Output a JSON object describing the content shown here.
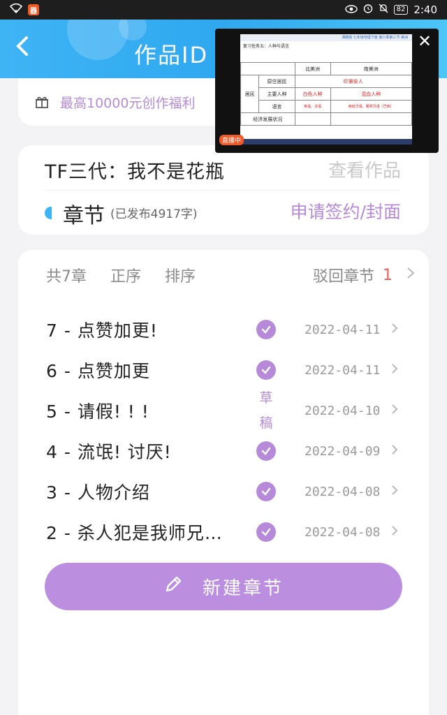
{
  "status_bar": {
    "time": "2:40",
    "battery": "82",
    "app_badge": "器"
  },
  "header": {
    "title": "作品ID",
    "back_label": "‹"
  },
  "benefit": {
    "text": "最高10000元创作福利"
  },
  "work": {
    "title": "TF三代：我不是花瓶",
    "view_works": "查看作品",
    "chapter_label": "章节",
    "published_count": "(已发布4917字)",
    "apply_sign": "申请签约/封面"
  },
  "chapter_list": {
    "total": "共7章",
    "order": "正序",
    "sort": "排序",
    "rejected_label": "驳回章节",
    "rejected_count": "1",
    "chapters": [
      {
        "title": "7 - 点赞加更!",
        "status": "published",
        "date": "2022-04-11"
      },
      {
        "title": "6 - 点赞加更",
        "status": "published",
        "date": "2022-04-11"
      },
      {
        "title": "5 - 请假! ! !",
        "status": "draft",
        "draft_label": "草稿",
        "date": "2022-04-10"
      },
      {
        "title": "4 - 流氓! 讨厌!",
        "status": "published",
        "date": "2022-04-09"
      },
      {
        "title": "3 - 人物介绍",
        "status": "published",
        "date": "2022-04-08"
      },
      {
        "title": "2 - 杀人犯是我师兄…",
        "status": "published",
        "date": "2022-04-08"
      }
    ],
    "new_chapter": "新建章节"
  },
  "floating_video": {
    "close": "✕",
    "live_badge": "直播中",
    "slide_header": "湘教版 七年级地理下册 第六章第三节 美洲",
    "slide_caption": "复习任务五：人种与语言",
    "col_north": "北美洲",
    "col_south": "南美洲",
    "row_residents": "居民",
    "row_native": "原住居民",
    "row_native_value": "印第安人",
    "row_race": "主要人种",
    "row_race_north": "白色人种",
    "row_race_south": "混血人种",
    "row_language": "语言",
    "row_language_north": "英语、法语",
    "row_language_south": "西班牙语、葡萄牙语（巴西）",
    "row_economy": "经济发展状况"
  }
}
